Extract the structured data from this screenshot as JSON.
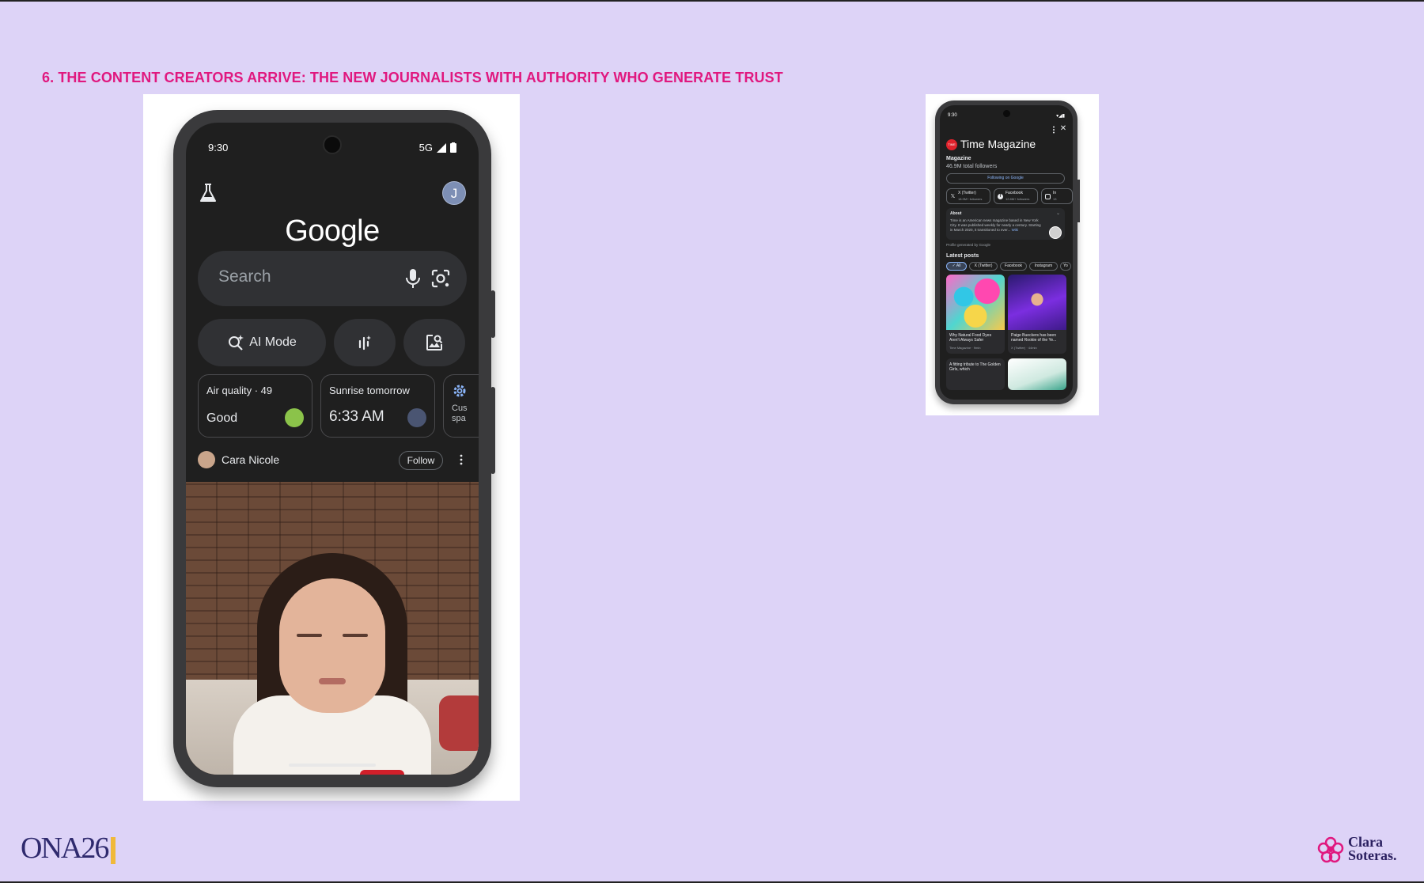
{
  "slide": {
    "title": "6. THE CONTENT CREATORS ARRIVE: THE NEW JOURNALISTS WITH AUTHORITY WHO GENERATE TRUST",
    "title_color": "#e0187f",
    "background_color": "#ddd3f7"
  },
  "phone_left": {
    "status_time": "9:30",
    "status_network": "5G",
    "avatar_letter": "J",
    "brand": "Google",
    "search_placeholder": "Search",
    "ai_mode_label": "AI Mode",
    "air_quality": {
      "label": "Air quality · 49",
      "value": "Good"
    },
    "sunrise": {
      "label": "Sunrise tomorrow",
      "value": "6:33 AM"
    },
    "customize_label": "Cus\nspa",
    "creator": {
      "name": "Cara Nicole",
      "follow_label": "Follow"
    }
  },
  "phone_right": {
    "status_time": "9:30",
    "logo_text": "TIME",
    "title": "Time Magazine",
    "subtitle": "Magazine",
    "followers": "46.9M total followers",
    "following_button": "Following on Google",
    "socials": [
      {
        "name": "X (Twitter)",
        "count": "18.9M+ followers"
      },
      {
        "name": "Facebook",
        "count": "12.8M+ followers"
      },
      {
        "name": "In",
        "count": "13"
      }
    ],
    "about": {
      "heading": "About",
      "text": "Time is an American news magazine based in New York City. It was published weekly for nearly a century. Starting in March 2020, it transitioned to ever...",
      "more": "Wiki"
    },
    "profile_note": "Profile generated by Google",
    "latest_posts_heading": "Latest posts",
    "filters": [
      "All",
      "X (Twitter)",
      "Facebook",
      "Instagram",
      "Yo"
    ],
    "posts": [
      {
        "caption": "Why Natural Food Dyes Aren't Always Safer",
        "source": "Time Magazine · 9min"
      },
      {
        "caption": "Paige Bueckers has been named Rookie of the Ye...",
        "source": "X (Twitter) · 44min"
      }
    ],
    "posts_row2": [
      {
        "caption": "A fitting tribute to The Golden Girls, which"
      }
    ]
  },
  "footer": {
    "ona_logo_text": "ONA26",
    "clara_logo_text": "Clara\nSoteras."
  }
}
